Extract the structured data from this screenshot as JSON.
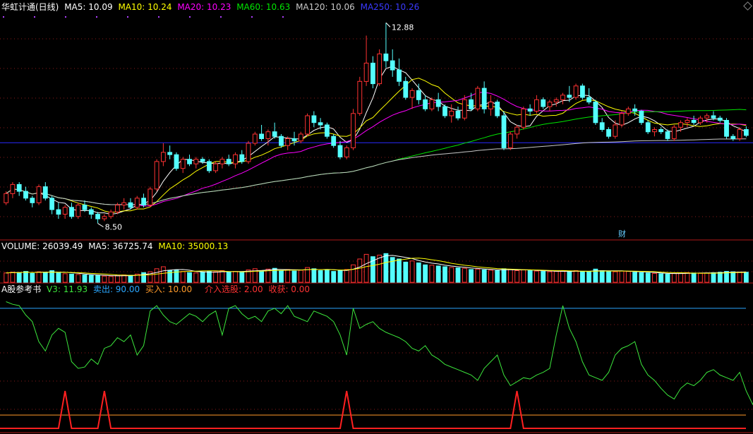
{
  "main_header": {
    "title": "华虹计通(日线)",
    "ma5": "MA5: 10.09",
    "ma10": "MA10: 10.24",
    "ma20": "MA20: 10.23",
    "ma60": "MA60: 10.63",
    "ma120": "MA120: 10.06",
    "ma250": "MA250: 10.26"
  },
  "volume_header": {
    "title": "VOLUME: 26039.49",
    "ma5": "MA5: 36725.74",
    "ma10": "MA10: 35000.13"
  },
  "indicator_header": {
    "title": "A股参考书",
    "v3": "V3: 11.93",
    "sell": "卖出: 90.00",
    "buy": "买入: 10.00",
    "pick": "介入选股: 2.00",
    "profit": "收获: 0.00"
  },
  "annotations": {
    "high": "12.88",
    "low": "8.50",
    "fin_marker": "财"
  },
  "colors": {
    "up": "#ff3232",
    "down": "#54ffff",
    "ma5": "#ffffff",
    "ma10": "#ffff00",
    "ma20": "#ff00ff",
    "ma60": "#00e600",
    "ma120": "#c8c8c8",
    "ma250": "#2b2bff",
    "sell_line": "#2aa7ff",
    "buy_line": "#ff9a2a",
    "divider": "#b01818"
  },
  "chart_data": [
    {
      "type": "candlestick",
      "title": "华虹计通(日线)",
      "ylim": [
        8.2,
        13.1
      ],
      "price_high": 12.88,
      "price_low": 8.5,
      "ma250_level": 10.26,
      "ohlc": [
        [
          8.95,
          9.2,
          8.9,
          9.15
        ],
        [
          9.15,
          9.4,
          9.05,
          9.35
        ],
        [
          9.35,
          9.4,
          9.1,
          9.2
        ],
        [
          9.2,
          9.3,
          9.0,
          9.05
        ],
        [
          9.05,
          9.1,
          8.85,
          8.95
        ],
        [
          8.95,
          9.35,
          8.9,
          9.3
        ],
        [
          9.3,
          9.4,
          9.0,
          9.05
        ],
        [
          9.05,
          9.1,
          8.7,
          8.8
        ],
        [
          8.8,
          8.95,
          8.6,
          8.7
        ],
        [
          8.7,
          8.9,
          8.6,
          8.85
        ],
        [
          8.85,
          8.95,
          8.6,
          8.65
        ],
        [
          8.65,
          8.95,
          8.6,
          8.9
        ],
        [
          8.9,
          9.0,
          8.75,
          8.8
        ],
        [
          8.8,
          8.85,
          8.6,
          8.7
        ],
        [
          8.7,
          8.75,
          8.5,
          8.6
        ],
        [
          8.6,
          8.7,
          8.55,
          8.65
        ],
        [
          8.65,
          8.8,
          8.6,
          8.75
        ],
        [
          8.75,
          8.95,
          8.7,
          8.9
        ],
        [
          8.9,
          9.05,
          8.8,
          8.95
        ],
        [
          8.95,
          9.05,
          8.8,
          8.85
        ],
        [
          8.85,
          9.1,
          8.8,
          9.05
        ],
        [
          9.05,
          9.15,
          8.85,
          8.9
        ],
        [
          8.9,
          9.3,
          8.85,
          9.25
        ],
        [
          9.25,
          9.9,
          9.2,
          9.85
        ],
        [
          9.85,
          10.25,
          9.75,
          10.05
        ],
        [
          10.05,
          10.2,
          9.9,
          10.0
        ],
        [
          10.0,
          10.05,
          9.65,
          9.7
        ],
        [
          9.7,
          9.95,
          9.6,
          9.9
        ],
        [
          9.9,
          10.0,
          9.75,
          9.8
        ],
        [
          9.8,
          9.95,
          9.7,
          9.9
        ],
        [
          9.9,
          9.95,
          9.8,
          9.85
        ],
        [
          9.85,
          9.9,
          9.6,
          9.65
        ],
        [
          9.65,
          9.85,
          9.6,
          9.8
        ],
        [
          9.8,
          9.95,
          9.7,
          9.9
        ],
        [
          9.9,
          10.0,
          9.75,
          9.8
        ],
        [
          9.8,
          10.05,
          9.7,
          10.0
        ],
        [
          10.0,
          10.1,
          9.8,
          9.85
        ],
        [
          9.85,
          10.3,
          9.8,
          10.25
        ],
        [
          10.25,
          10.5,
          10.2,
          10.45
        ],
        [
          10.45,
          10.65,
          10.3,
          10.35
        ],
        [
          10.35,
          10.55,
          10.2,
          10.5
        ],
        [
          10.5,
          10.7,
          10.35,
          10.4
        ],
        [
          10.4,
          10.45,
          10.15,
          10.2
        ],
        [
          10.2,
          10.4,
          10.1,
          10.35
        ],
        [
          10.35,
          10.5,
          10.2,
          10.3
        ],
        [
          10.3,
          10.5,
          10.25,
          10.45
        ],
        [
          10.45,
          10.9,
          10.4,
          10.85
        ],
        [
          10.85,
          10.95,
          10.6,
          10.7
        ],
        [
          10.7,
          10.8,
          10.55,
          10.65
        ],
        [
          10.65,
          10.7,
          10.35,
          10.4
        ],
        [
          10.4,
          10.45,
          10.15,
          10.2
        ],
        [
          10.2,
          10.3,
          9.9,
          9.95
        ],
        [
          9.95,
          10.2,
          9.9,
          10.15
        ],
        [
          10.15,
          11.0,
          10.1,
          10.9
        ],
        [
          10.9,
          11.7,
          10.85,
          11.6
        ],
        [
          11.6,
          12.6,
          11.5,
          12.0
        ],
        [
          12.0,
          12.15,
          11.45,
          11.55
        ],
        [
          11.55,
          12.3,
          11.5,
          12.2
        ],
        [
          12.2,
          12.88,
          11.9,
          12.05
        ],
        [
          12.05,
          12.3,
          11.7,
          11.85
        ],
        [
          11.85,
          12.1,
          11.5,
          11.6
        ],
        [
          11.6,
          11.7,
          11.2,
          11.25
        ],
        [
          11.25,
          11.45,
          11.0,
          11.4
        ],
        [
          11.4,
          11.55,
          11.1,
          11.2
        ],
        [
          11.2,
          11.3,
          10.95,
          11.0
        ],
        [
          11.0,
          11.25,
          10.95,
          11.2
        ],
        [
          11.2,
          11.35,
          10.95,
          11.05
        ],
        [
          11.05,
          11.1,
          10.8,
          10.85
        ],
        [
          10.85,
          11.1,
          10.7,
          10.95
        ],
        [
          10.95,
          11.05,
          10.75,
          10.8
        ],
        [
          10.8,
          11.3,
          10.75,
          11.2
        ],
        [
          11.2,
          11.35,
          10.95,
          11.0
        ],
        [
          11.0,
          11.5,
          10.95,
          11.45
        ],
        [
          11.45,
          11.6,
          10.9,
          11.0
        ],
        [
          11.0,
          11.3,
          10.85,
          11.15
        ],
        [
          11.15,
          11.2,
          10.8,
          10.85
        ],
        [
          10.85,
          10.95,
          10.1,
          10.15
        ],
        [
          10.15,
          10.5,
          10.1,
          10.45
        ],
        [
          10.45,
          10.65,
          10.35,
          10.6
        ],
        [
          10.6,
          11.05,
          10.55,
          11.0
        ],
        [
          11.0,
          11.1,
          10.85,
          10.95
        ],
        [
          10.95,
          11.3,
          10.9,
          11.2
        ],
        [
          11.2,
          11.25,
          11.0,
          11.05
        ],
        [
          11.05,
          11.2,
          10.95,
          11.15
        ],
        [
          11.15,
          11.25,
          11.05,
          11.2
        ],
        [
          11.2,
          11.35,
          11.1,
          11.3
        ],
        [
          11.3,
          11.5,
          11.15,
          11.25
        ],
        [
          11.25,
          11.55,
          11.2,
          11.5
        ],
        [
          11.5,
          11.55,
          11.2,
          11.25
        ],
        [
          11.25,
          11.45,
          11.1,
          11.15
        ],
        [
          11.15,
          11.2,
          10.65,
          10.7
        ],
        [
          10.7,
          10.8,
          10.5,
          10.55
        ],
        [
          10.55,
          10.6,
          10.35,
          10.4
        ],
        [
          10.4,
          10.75,
          10.35,
          10.65
        ],
        [
          10.65,
          10.95,
          10.6,
          10.9
        ],
        [
          10.9,
          11.05,
          10.85,
          11.0
        ],
        [
          11.0,
          11.1,
          10.85,
          10.95
        ],
        [
          10.95,
          10.98,
          10.65,
          10.7
        ],
        [
          10.7,
          10.75,
          10.45,
          10.5
        ],
        [
          10.5,
          10.6,
          10.4,
          10.55
        ],
        [
          10.55,
          10.6,
          10.45,
          10.5
        ],
        [
          10.5,
          10.55,
          10.3,
          10.35
        ],
        [
          10.35,
          10.65,
          10.3,
          10.6
        ],
        [
          10.6,
          10.75,
          10.5,
          10.7
        ],
        [
          10.7,
          10.8,
          10.6,
          10.75
        ],
        [
          10.75,
          10.85,
          10.65,
          10.7
        ],
        [
          10.7,
          10.85,
          10.65,
          10.8
        ],
        [
          10.8,
          10.9,
          10.7,
          10.85
        ],
        [
          10.85,
          10.95,
          10.75,
          10.8
        ],
        [
          10.8,
          10.85,
          10.7,
          10.75
        ],
        [
          10.75,
          10.8,
          10.35,
          10.4
        ],
        [
          10.4,
          10.45,
          10.3,
          10.35
        ],
        [
          10.35,
          10.6,
          10.3,
          10.55
        ],
        [
          10.55,
          10.62,
          10.38,
          10.42
        ]
      ],
      "ma_periods": [
        5,
        10,
        20,
        60,
        120
      ]
    },
    {
      "type": "bar",
      "title": "VOLUME",
      "volumes": [
        24000,
        26000,
        25000,
        28000,
        23000,
        27000,
        26000,
        30000,
        24000,
        22000,
        21000,
        20000,
        19000,
        18000,
        17000,
        16000,
        15000,
        17000,
        19000,
        18000,
        21000,
        25000,
        27000,
        35000,
        40000,
        30000,
        32000,
        28000,
        25000,
        24000,
        26000,
        28000,
        27000,
        30000,
        26000,
        28000,
        27000,
        32000,
        35000,
        30000,
        34000,
        36000,
        30000,
        33000,
        29000,
        31000,
        38000,
        35000,
        30000,
        32000,
        28000,
        30000,
        33000,
        45000,
        60000,
        72000,
        66000,
        70000,
        74000,
        64000,
        60000,
        52000,
        55000,
        50000,
        45000,
        44000,
        42000,
        40000,
        38000,
        37000,
        36000,
        33000,
        34000,
        32000,
        31000,
        30000,
        35000,
        33000,
        30000,
        32000,
        30000,
        29000,
        28000,
        27000,
        28000,
        29000,
        28000,
        30000,
        27000,
        28000,
        34000,
        30000,
        28000,
        27000,
        29000,
        28000,
        26000,
        25000,
        24000,
        23000,
        22000,
        21000,
        23000,
        24000,
        25000,
        24000,
        23000,
        24000,
        25000,
        26000,
        28000,
        27000,
        26000,
        26039
      ],
      "vol_max": 80000
    },
    {
      "type": "line",
      "title": "A股参考书",
      "ylim": [
        0,
        100
      ],
      "sell_level": 90,
      "buy_level": 10,
      "v3": [
        95,
        93,
        92,
        85,
        80,
        65,
        58,
        70,
        75,
        72,
        50,
        45,
        46,
        52,
        48,
        60,
        62,
        68,
        65,
        70,
        55,
        62,
        88,
        92,
        85,
        80,
        78,
        82,
        86,
        84,
        80,
        85,
        88,
        70,
        90,
        92,
        86,
        82,
        84,
        80,
        88,
        90,
        86,
        92,
        84,
        82,
        80,
        88,
        86,
        84,
        80,
        70,
        55,
        90,
        75,
        78,
        80,
        75,
        72,
        70,
        68,
        65,
        60,
        58,
        62,
        55,
        52,
        48,
        46,
        44,
        42,
        40,
        36,
        45,
        50,
        55,
        40,
        32,
        35,
        38,
        37,
        40,
        42,
        45,
        70,
        92,
        75,
        65,
        50,
        40,
        38,
        36,
        42,
        55,
        60,
        62,
        65,
        48,
        40,
        36,
        30,
        25,
        22,
        30,
        34,
        32,
        36,
        42,
        44,
        40,
        38,
        36,
        42,
        28,
        18,
        30,
        20
      ],
      "pick": [
        0,
        0,
        0,
        0,
        0,
        0,
        0,
        0,
        0,
        0,
        0,
        0,
        0,
        0,
        0,
        0,
        0,
        0,
        0,
        0,
        0,
        0,
        0,
        0,
        0,
        0,
        0,
        0,
        0,
        0,
        0,
        0,
        0,
        0,
        0,
        0,
        0,
        0,
        0,
        0,
        0,
        0,
        0,
        0,
        0,
        0,
        0,
        0,
        0,
        0,
        0,
        0,
        0,
        0,
        0,
        0,
        0,
        0,
        0,
        0,
        0,
        0,
        0,
        0,
        0,
        0,
        0,
        0,
        0,
        0,
        0,
        0,
        0,
        0,
        0,
        0,
        0,
        0,
        0,
        0,
        0,
        0,
        0,
        0,
        0,
        0,
        0,
        0,
        0,
        0,
        0,
        0,
        0,
        0,
        0,
        0,
        0,
        0,
        0,
        0,
        0,
        0,
        0,
        0,
        0,
        0,
        0,
        0,
        0,
        0,
        0,
        0,
        0,
        0,
        0
      ],
      "pick_spikes_at": [
        9,
        15,
        52,
        78
      ],
      "pick_spike_value": 28,
      "profit": 0
    }
  ]
}
